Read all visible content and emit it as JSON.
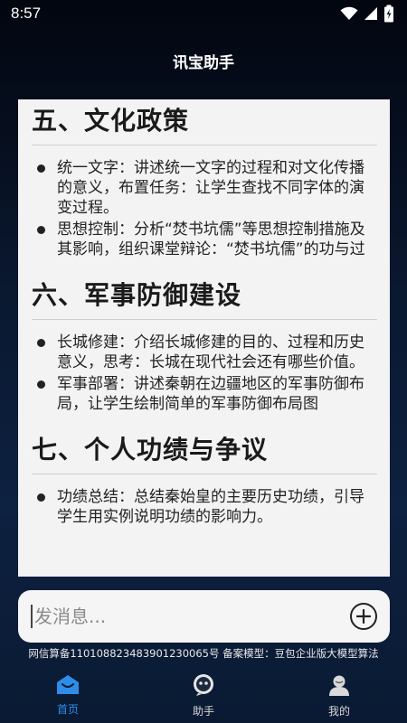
{
  "status_bar": {
    "time": "8:57"
  },
  "header": {
    "title": "讯宝助手"
  },
  "content": {
    "sections": [
      {
        "heading": "五、文化政策",
        "bullets": [
          "统一文字：讲述统一文字的过程和对文化传播的意义，布置任务：让学生查找不同字体的演变过程。",
          "思想控制：分析“焚书坑儒”等思想控制措施及其影响，组织课堂辩论：“焚书坑儒”的功与过"
        ]
      },
      {
        "heading": "六、军事防御建设",
        "bullets": [
          "长城修建：介绍长城修建的目的、过程和历史意义，思考：长城在现代社会还有哪些价值。",
          "军事部署：讲述秦朝在边疆地区的军事防御布局，让学生绘制简单的军事防御布局图"
        ]
      },
      {
        "heading": "七、个人功绩与争议",
        "bullets": [
          "功绩总结：总结秦始皇的主要历史功绩，引导学生用实例说明功绩的影响力。"
        ]
      }
    ]
  },
  "input": {
    "placeholder": "发消息..."
  },
  "footer": {
    "note": "网信算备110108823483901230065号 备案模型：豆包企业版大模型算法"
  },
  "nav": {
    "items": [
      {
        "label": "首页",
        "icon": "home-icon"
      },
      {
        "label": "助手",
        "icon": "assistant-icon"
      },
      {
        "label": "我的",
        "icon": "profile-icon"
      }
    ]
  },
  "colors": {
    "accent": "#2f8dea",
    "card_bg": "#f3f3f3"
  }
}
